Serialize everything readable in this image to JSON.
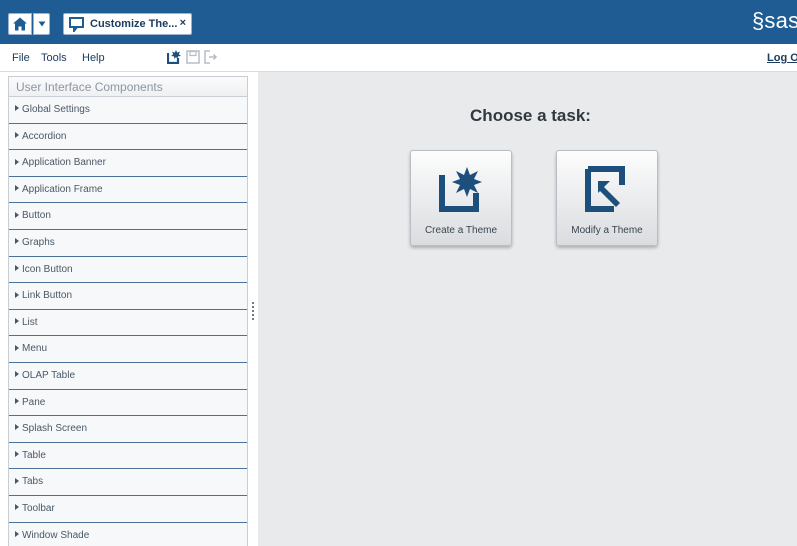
{
  "banner": {
    "tab_label": "Customize The...",
    "tab_close": "×",
    "logo": "§sas",
    "icons": {
      "home": "home-icon",
      "dropdown": "chevron-down-icon",
      "tab": "presentation-icon"
    }
  },
  "menubar": {
    "items": [
      "File",
      "Tools",
      "Help"
    ],
    "toolbar_icons": [
      "new-document-icon",
      "save-icon",
      "exit-icon"
    ],
    "logoff": "Log Off"
  },
  "nav": {
    "header": "User Interface Components",
    "items": [
      "Global Settings",
      "Accordion",
      "Application Banner",
      "Application Frame",
      "Button",
      "Graphs",
      "Icon Button",
      "Link Button",
      "List",
      "Menu",
      "OLAP Table",
      "Pane",
      "Splash Screen",
      "Table",
      "Tabs",
      "Toolbar",
      "Window Shade"
    ]
  },
  "main": {
    "title": "Choose a task:",
    "tasks": [
      {
        "label": "Create a Theme",
        "icon": "create-theme-icon"
      },
      {
        "label": "Modify a Theme",
        "icon": "modify-theme-icon"
      }
    ]
  },
  "colors": {
    "banner": "#1f5c93",
    "accent": "#1c4f7c",
    "panel": "#e9eaec"
  }
}
